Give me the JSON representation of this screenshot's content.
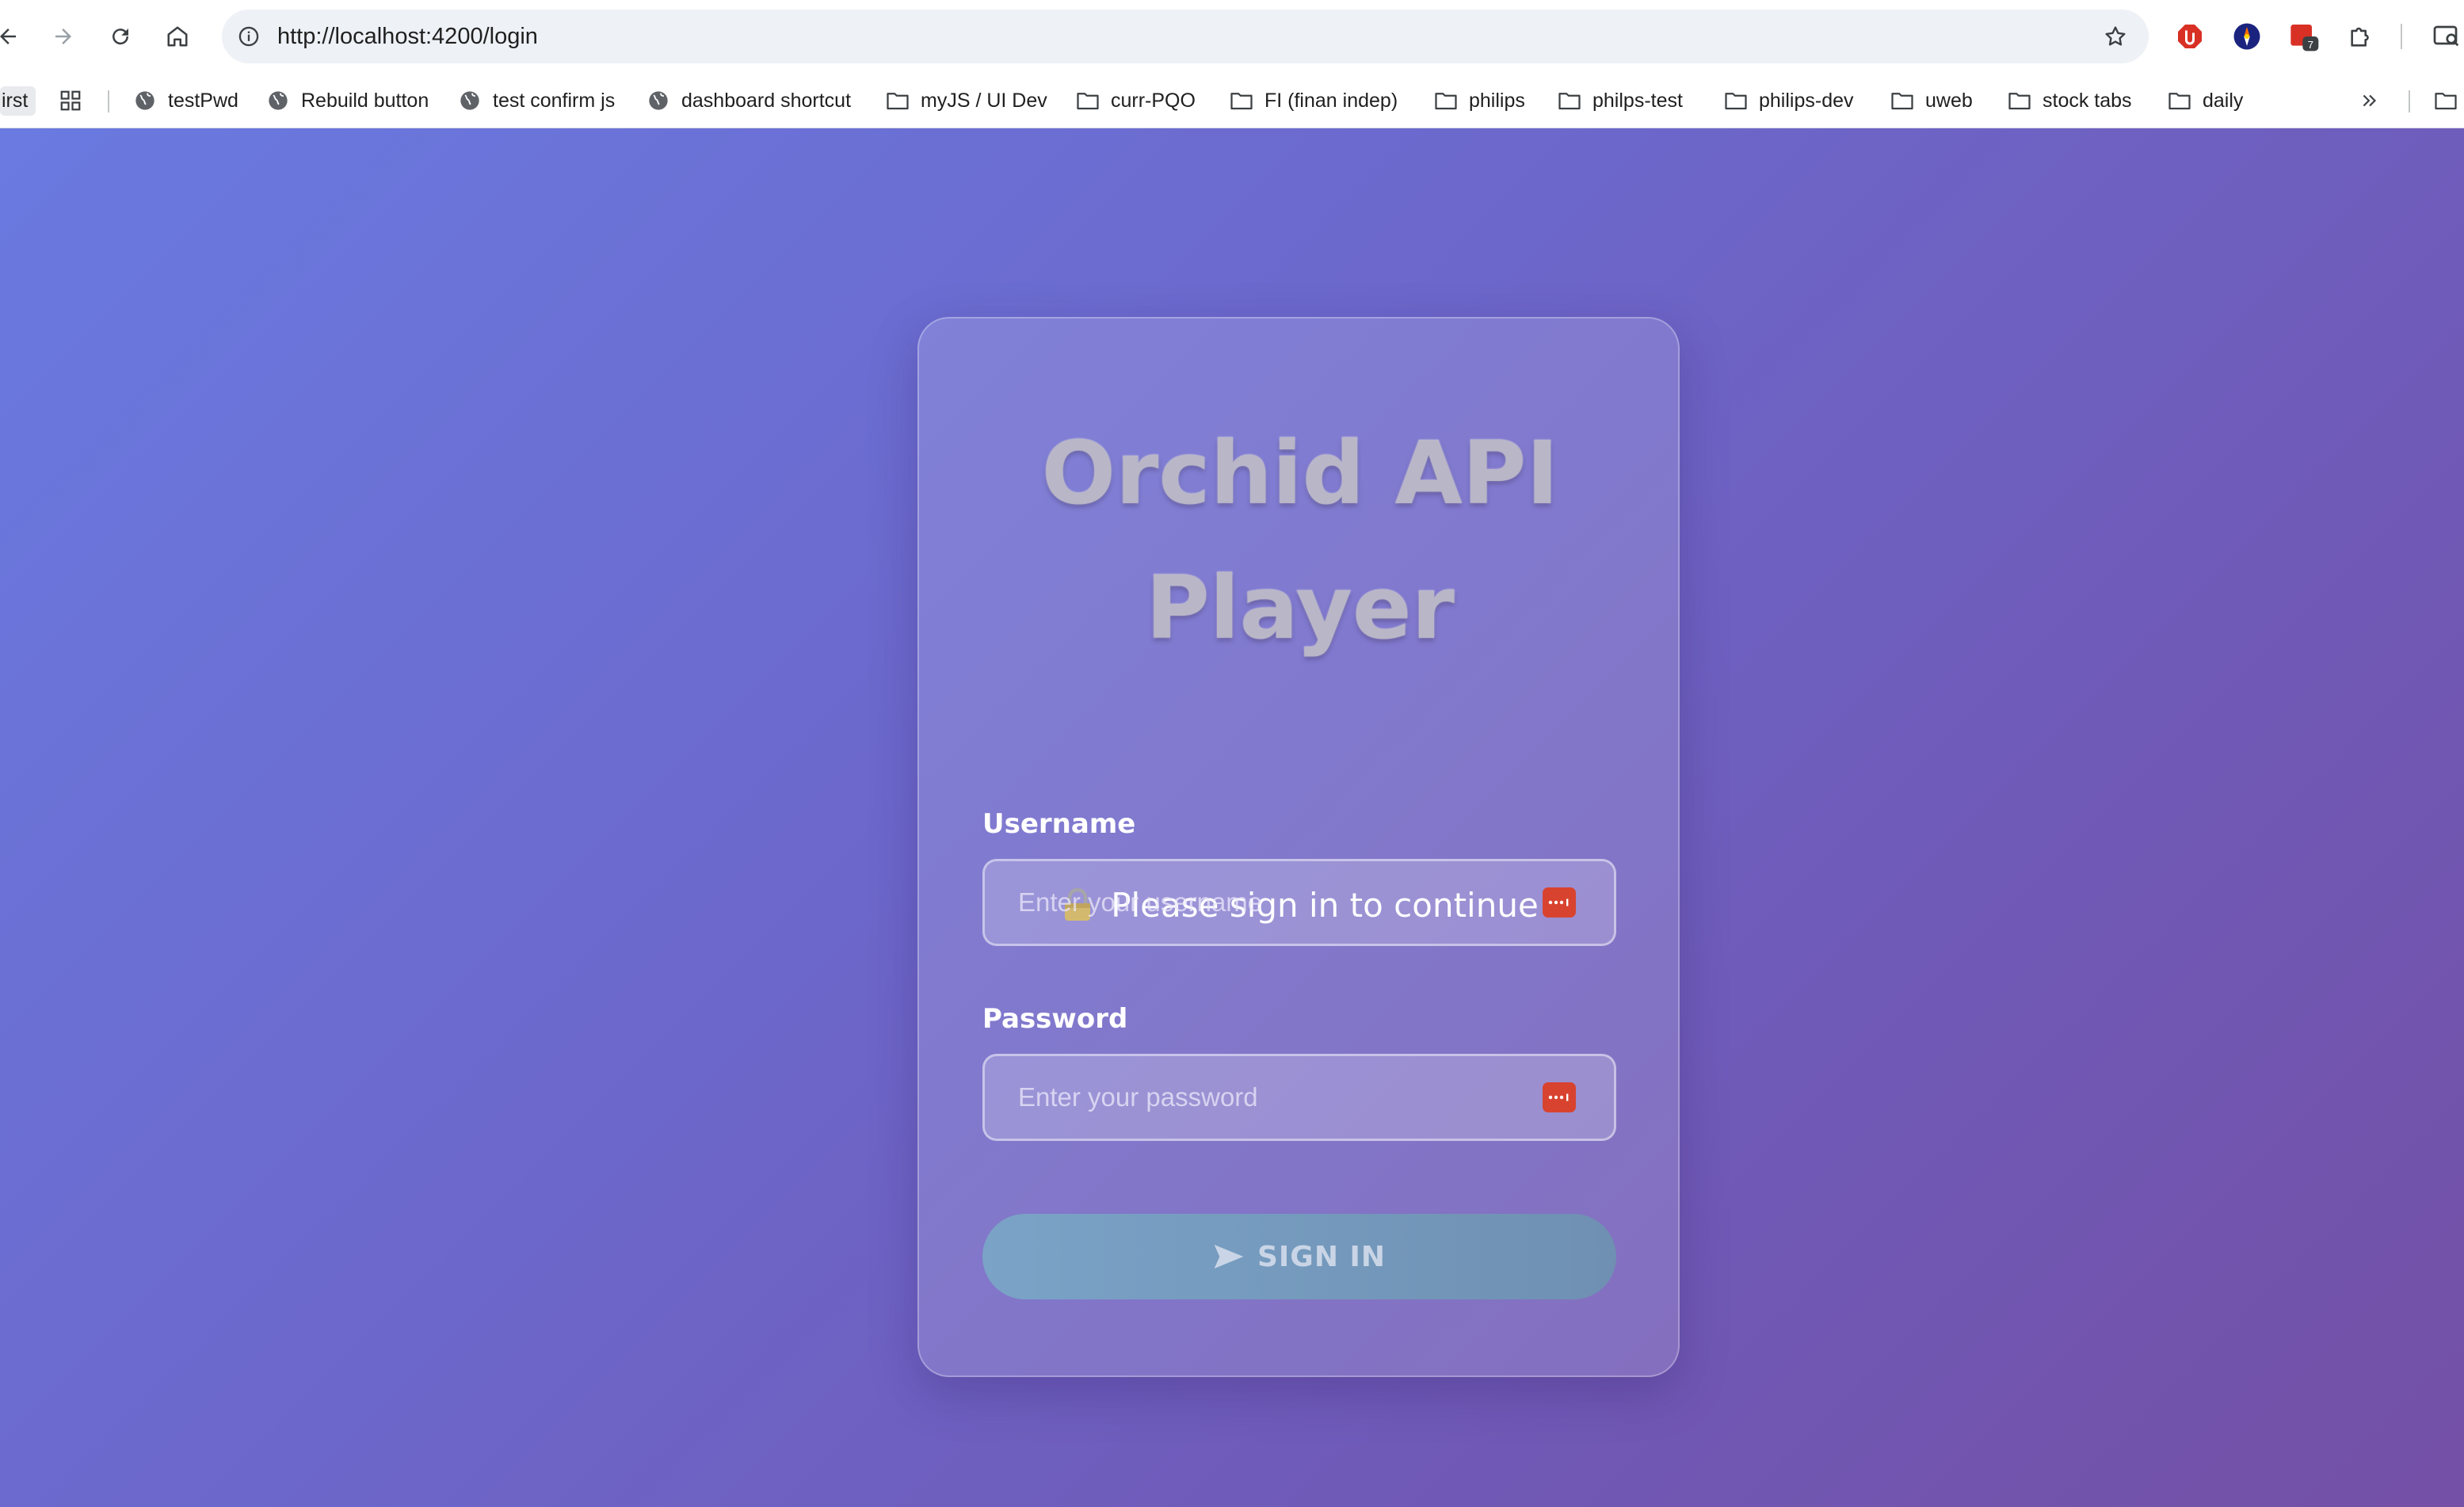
{
  "browser": {
    "url": "http://localhost:4200/login",
    "extension_badge": "7",
    "bookmarks": [
      {
        "label": "irst",
        "type": "partial"
      },
      {
        "label": "testPwd",
        "type": "site"
      },
      {
        "label": "Rebuild button",
        "type": "site"
      },
      {
        "label": "test confirm js",
        "type": "site"
      },
      {
        "label": "dashboard shortcut",
        "type": "site"
      },
      {
        "label": "myJS / UI Dev",
        "type": "folder"
      },
      {
        "label": "curr-PQO",
        "type": "folder"
      },
      {
        "label": "FI (finan indep)",
        "type": "folder"
      },
      {
        "label": "philips",
        "type": "folder"
      },
      {
        "label": "philps-test",
        "type": "folder"
      },
      {
        "label": "philips-dev",
        "type": "folder"
      },
      {
        "label": "uweb",
        "type": "folder"
      },
      {
        "label": "stock tabs",
        "type": "folder"
      },
      {
        "label": "daily",
        "type": "folder"
      }
    ]
  },
  "login": {
    "title": "Orchid API Player",
    "subtitle": "Please sign in to continue",
    "username_label": "Username",
    "username_placeholder": "Enter your username",
    "password_label": "Password",
    "password_placeholder": "Enter your password",
    "submit_label": "SIGN IN"
  },
  "colors": {
    "background_start": "#6a7ae0",
    "background_end": "#7450a6",
    "button": "#7aa3c7",
    "password_manager_icon": "#d8432f"
  }
}
